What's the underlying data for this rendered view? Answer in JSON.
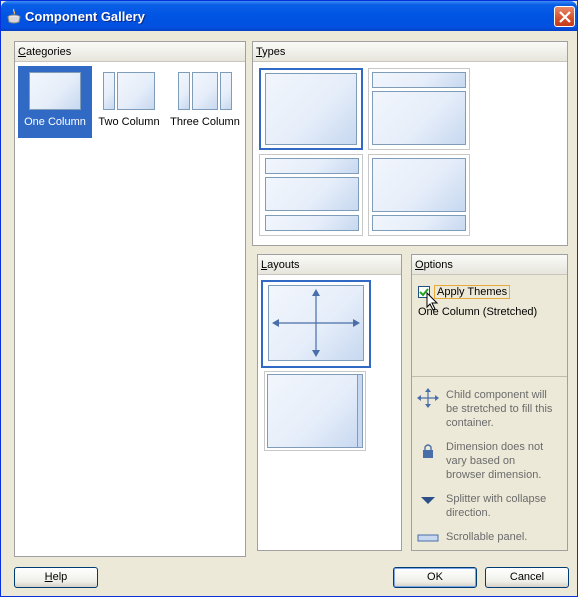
{
  "window": {
    "title": "Component Gallery"
  },
  "categories": {
    "header": "Categories",
    "items": [
      {
        "label": "One Column",
        "selected": true
      },
      {
        "label": "Two Column",
        "selected": false
      },
      {
        "label": "Three Column",
        "selected": false
      }
    ]
  },
  "types": {
    "header": "Types"
  },
  "layouts": {
    "header": "Layouts"
  },
  "options": {
    "header": "Options",
    "apply_themes_label": "Apply Themes",
    "apply_themes_checked": true,
    "selected_desc": "One Column (Stretched)",
    "legend": [
      {
        "icon": "stretch-arrows-icon",
        "text": "Child component will be stretched to fill this container."
      },
      {
        "icon": "lock-icon",
        "text": "Dimension does not vary based on browser dimension."
      },
      {
        "icon": "triangle-down-icon",
        "text": "Splitter with collapse direction."
      },
      {
        "icon": "scroll-bar-icon",
        "text": "Scrollable panel."
      }
    ]
  },
  "buttons": {
    "help": "Help",
    "ok": "OK",
    "cancel": "Cancel"
  },
  "colors": {
    "selection": "#316ac5",
    "title_bar": "#0054e3",
    "dialog_bg": "#ece9d8"
  }
}
